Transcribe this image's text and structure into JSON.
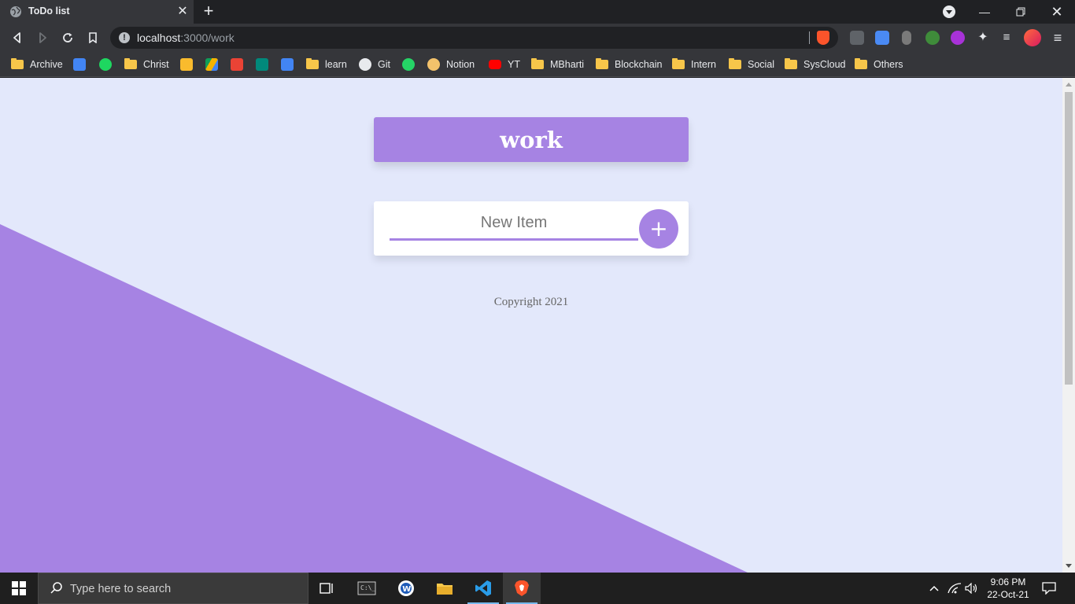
{
  "browser": {
    "tab_title": "ToDo list",
    "url_host": "localhost",
    "url_path": ":3000/work"
  },
  "bookmarks": [
    {
      "label": "Archive",
      "type": "folder"
    },
    {
      "label": "",
      "type": "google-forms-icon"
    },
    {
      "label": "",
      "type": "spotify-icon"
    },
    {
      "label": "Christ",
      "type": "folder"
    },
    {
      "label": "",
      "type": "google-classroom-icon"
    },
    {
      "label": "",
      "type": "google-drive-icon"
    },
    {
      "label": "",
      "type": "gmail-icon"
    },
    {
      "label": "",
      "type": "google-meet-icon"
    },
    {
      "label": "",
      "type": "google-calendar-icon"
    },
    {
      "label": "learn",
      "type": "folder"
    },
    {
      "label": "Git",
      "type": "github-icon"
    },
    {
      "label": "",
      "type": "whatsapp-icon"
    },
    {
      "label": "Notion",
      "type": "notion-icon"
    },
    {
      "label": "YT",
      "type": "youtube-icon"
    },
    {
      "label": "MBharti",
      "type": "folder"
    },
    {
      "label": "Blockchain",
      "type": "folder"
    },
    {
      "label": "Intern",
      "type": "folder"
    },
    {
      "label": "Social",
      "type": "folder"
    },
    {
      "label": "SysCloud",
      "type": "folder"
    },
    {
      "label": "Others",
      "type": "folder"
    }
  ],
  "app": {
    "list_title": "work",
    "new_item_placeholder": "New Item",
    "add_button_label": "+",
    "footer": "Copyright 2021"
  },
  "colors": {
    "accent": "#a683e3",
    "page_background": "#e3e8fb"
  },
  "taskbar": {
    "search_placeholder": "Type here to search",
    "time": "9:06 PM",
    "date": "22-Oct-21"
  }
}
